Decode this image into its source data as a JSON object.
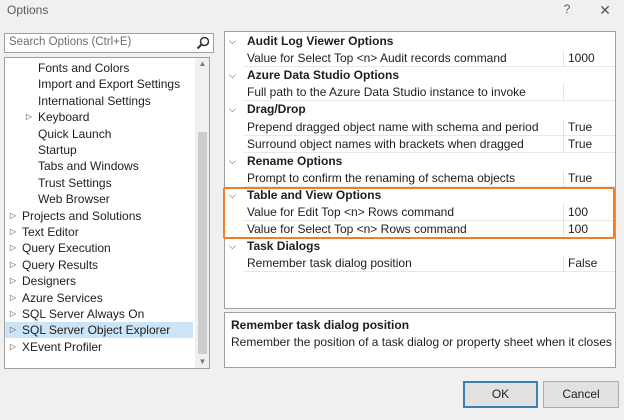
{
  "window": {
    "title": "Options",
    "help_glyph": "?",
    "close_glyph": "✕"
  },
  "search": {
    "placeholder": "Search Options (Ctrl+E)"
  },
  "tree": {
    "items": [
      {
        "label": "Fonts and Colors",
        "arrow": ""
      },
      {
        "label": "Import and Export Settings",
        "arrow": ""
      },
      {
        "label": "International Settings",
        "arrow": ""
      },
      {
        "label": "Keyboard",
        "arrow": "▷"
      },
      {
        "label": "Quick Launch",
        "arrow": ""
      },
      {
        "label": "Startup",
        "arrow": ""
      },
      {
        "label": "Tabs and Windows",
        "arrow": ""
      },
      {
        "label": "Trust Settings",
        "arrow": ""
      },
      {
        "label": "Web Browser",
        "arrow": ""
      },
      {
        "label": "Projects and Solutions",
        "arrow": "▷"
      },
      {
        "label": "Text Editor",
        "arrow": "▷"
      },
      {
        "label": "Query Execution",
        "arrow": "▷"
      },
      {
        "label": "Query Results",
        "arrow": "▷"
      },
      {
        "label": "Designers",
        "arrow": "▷"
      },
      {
        "label": "Azure Services",
        "arrow": "▷"
      },
      {
        "label": "SQL Server Always On",
        "arrow": "▷"
      },
      {
        "label": "SQL Server Object Explorer",
        "arrow": "▷"
      },
      {
        "label": "XEvent Profiler",
        "arrow": "▷"
      }
    ]
  },
  "grid": {
    "categories": [
      {
        "name": "Audit Log Viewer Options",
        "arrow": "⌵",
        "props": [
          {
            "name": "Value for Select Top <n> Audit records command",
            "value": "1000"
          }
        ]
      },
      {
        "name": "Azure Data Studio Options",
        "arrow": "⌵",
        "props": [
          {
            "name": "Full path to the Azure Data Studio instance to invoke",
            "value": ""
          }
        ]
      },
      {
        "name": "Drag/Drop",
        "arrow": "⌵",
        "props": [
          {
            "name": "Prepend dragged object name with schema and period",
            "value": "True"
          },
          {
            "name": "Surround object names with brackets when dragged",
            "value": "True"
          }
        ]
      },
      {
        "name": "Rename Options",
        "arrow": "⌵",
        "props": [
          {
            "name": "Prompt to confirm the renaming of schema objects",
            "value": "True"
          }
        ]
      },
      {
        "name": "Table and View Options",
        "arrow": "⌵",
        "props": [
          {
            "name": "Value for Edit Top <n> Rows command",
            "value": "100"
          },
          {
            "name": "Value for Select Top <n> Rows command",
            "value": "100"
          }
        ]
      },
      {
        "name": "Task Dialogs",
        "arrow": "⌵",
        "props": [
          {
            "name": "Remember task dialog position",
            "value": "False"
          }
        ]
      }
    ]
  },
  "description": {
    "title": "Remember task dialog position",
    "text": "Remember the position of a task dialog or property sheet when it closes. W..."
  },
  "buttons": {
    "ok": "OK",
    "cancel": "Cancel"
  },
  "colors": {
    "highlight": "#f07e26",
    "selection": "#cce4f7",
    "ok_border": "#3c7fb1"
  }
}
